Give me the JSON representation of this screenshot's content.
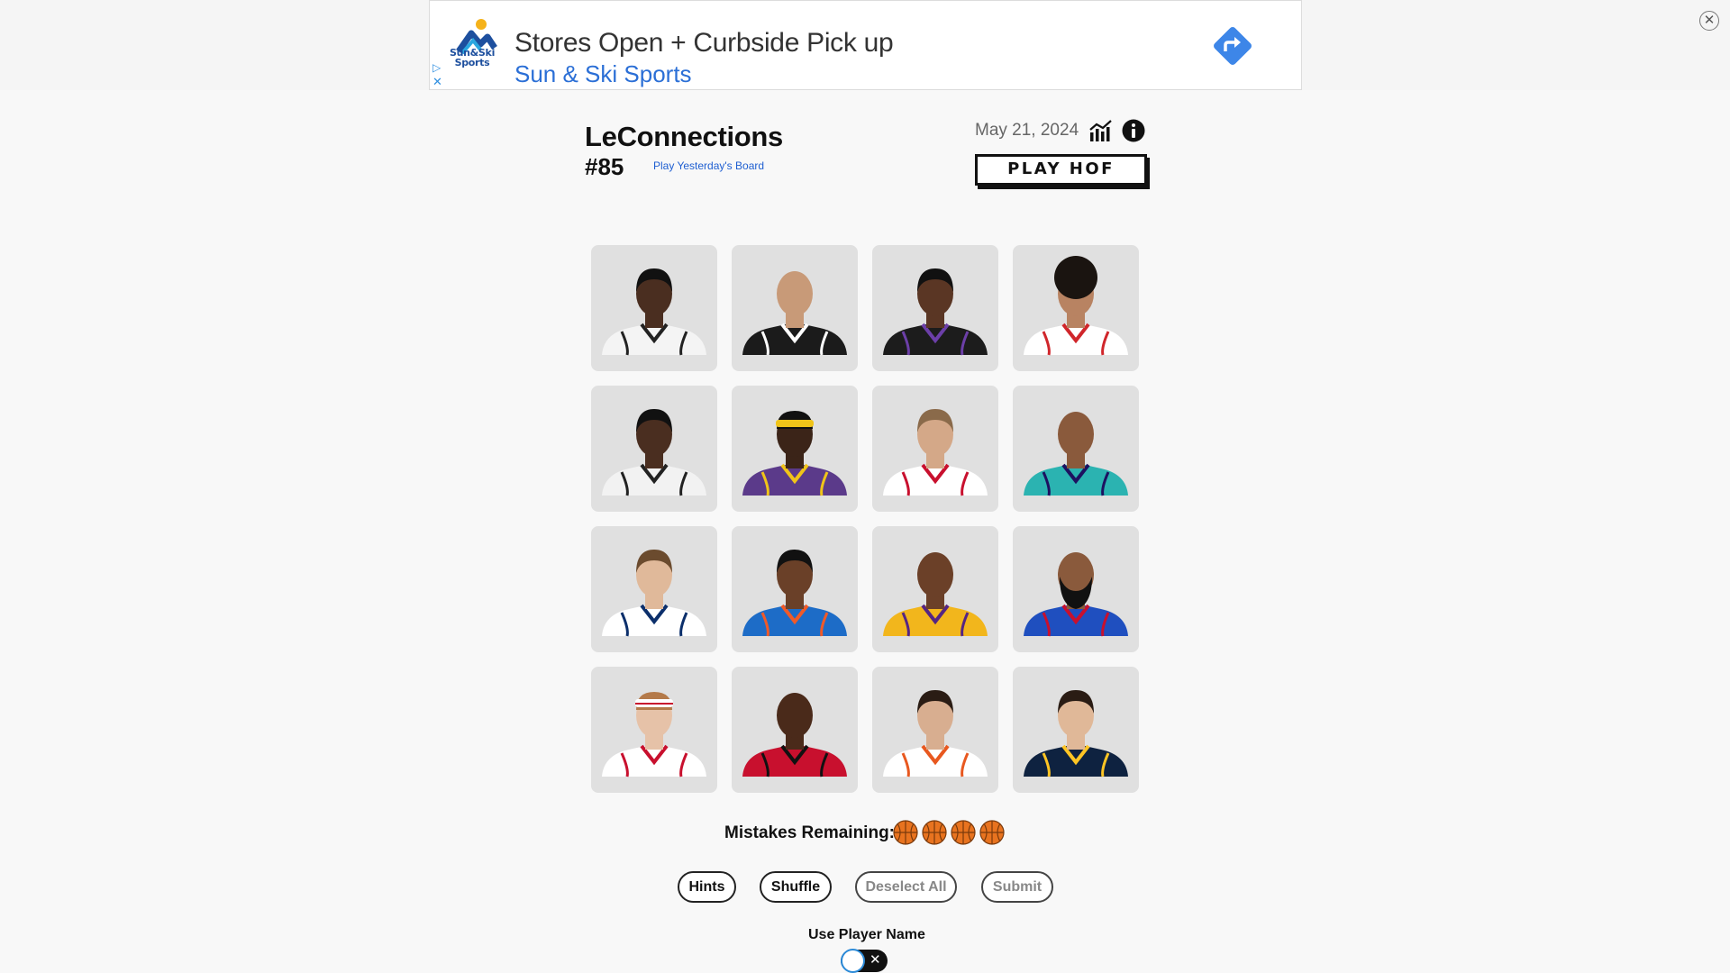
{
  "ad": {
    "headline": "Stores Open + Curbside Pick up",
    "brand": "Sun & Ski Sports",
    "logo_text": "Sun&Ski Sports",
    "adchoices_icon": "play-triangle-icon",
    "ad_close_icon": "x-icon",
    "cta_icon": "directions-arrow-icon",
    "brand_color": "#2b6fd6"
  },
  "page_close_icon": "close-circle-icon",
  "header": {
    "title": "LeConnections",
    "puzzle_number": "#85",
    "yesterday_link": "Play Yesterday's Board",
    "date": "May 21, 2024",
    "stats_icon": "bar-chart-icon",
    "info_icon": "info-icon",
    "play_hof": "PLAY HOF"
  },
  "players": [
    {
      "skin": "#4a2e20",
      "hair": "#111111",
      "hair_style": "short",
      "jersey": "#f4f4f4",
      "trim": "#222222"
    },
    {
      "skin": "#c89a78",
      "hair": "#a07a5c",
      "hair_style": "bald",
      "jersey": "#1b1b1b",
      "trim": "#ffffff"
    },
    {
      "skin": "#5a3624",
      "hair": "#111111",
      "hair_style": "short",
      "jersey": "#1c1c1c",
      "trim": "#6c3fa8"
    },
    {
      "skin": "#b88362",
      "hair": "#1a1410",
      "hair_style": "curly",
      "jersey": "#ffffff",
      "trim": "#d0262b"
    },
    {
      "skin": "#4a2e20",
      "hair": "#111111",
      "hair_style": "short",
      "jersey": "#f2f2f2",
      "trim": "#222222"
    },
    {
      "skin": "#3b2418",
      "hair": "#f0c419",
      "hair_style": "headband",
      "jersey": "#5b3a8a",
      "trim": "#f0c419"
    },
    {
      "skin": "#d4a888",
      "hair": "#8a6a4a",
      "hair_style": "short",
      "jersey": "#ffffff",
      "trim": "#c8102e"
    },
    {
      "skin": "#8a5a3c",
      "hair": "#2a1c14",
      "hair_style": "bald",
      "jersey": "#2bb3b1",
      "trim": "#1d1160"
    },
    {
      "skin": "#e0b99a",
      "hair": "#6b4b2e",
      "hair_style": "short",
      "jersey": "#ffffff",
      "trim": "#0c2f6b"
    },
    {
      "skin": "#6a4028",
      "hair": "#111111",
      "hair_style": "short",
      "jersey": "#1d6cc7",
      "trim": "#f05a28"
    },
    {
      "skin": "#6b4028",
      "hair": "#3a2418",
      "hair_style": "bald",
      "jersey": "#f2b61c",
      "trim": "#552583"
    },
    {
      "skin": "#8a5a3c",
      "hair": "#111111",
      "hair_style": "beard",
      "jersey": "#1f4fbf",
      "trim": "#c8102e"
    },
    {
      "skin": "#e6c2a8",
      "hair": "#ffffff",
      "hair_style": "headband-white",
      "jersey": "#ffffff",
      "trim": "#c8102e"
    },
    {
      "skin": "#4a2a1a",
      "hair": "#1a0f0a",
      "hair_style": "bald",
      "jersey": "#c8102e",
      "trim": "#111111"
    },
    {
      "skin": "#d8ae90",
      "hair": "#2a1c14",
      "hair_style": "short",
      "jersey": "#ffffff",
      "trim": "#e8581f"
    },
    {
      "skin": "#e0b898",
      "hair": "#2a1c14",
      "hair_style": "short",
      "jersey": "#0e2240",
      "trim": "#fec524"
    }
  ],
  "mistakes": {
    "label": "Mistakes Remaining:",
    "remaining": 4,
    "icon": "basketball-icon"
  },
  "buttons": {
    "hints": "Hints",
    "shuffle": "Shuffle",
    "deselect_all": "Deselect All",
    "submit": "Submit"
  },
  "toggle": {
    "label": "Use Player Name",
    "on": false
  }
}
